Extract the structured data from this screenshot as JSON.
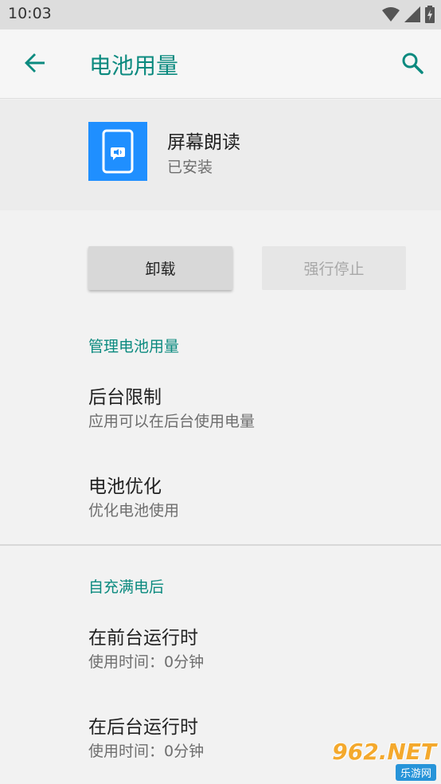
{
  "status_bar": {
    "time": "10:03",
    "icons": [
      "wifi-icon",
      "signal-icon",
      "battery-icon"
    ]
  },
  "app_bar": {
    "title": "电池用量",
    "back_icon": "arrow-back-icon",
    "search_icon": "search-icon",
    "accent_color": "#0b8a7f"
  },
  "app_info": {
    "name": "屏幕朗读",
    "status": "已安装",
    "icon_color": "#1f8fff"
  },
  "buttons": {
    "uninstall": "卸载",
    "force_stop": "强行停止"
  },
  "sections": {
    "manage": {
      "header": "管理电池用量",
      "items": [
        {
          "title": "后台限制",
          "summary": "应用可以在后台使用电量"
        },
        {
          "title": "电池优化",
          "summary": "优化电池使用"
        }
      ]
    },
    "since_full": {
      "header": "自充满电后",
      "items": [
        {
          "title": "在前台运行时",
          "summary": "使用时间：0分钟"
        },
        {
          "title": "在后台运行时",
          "summary": "使用时间：0分钟"
        }
      ]
    }
  },
  "watermark": {
    "main": "962.NET",
    "sub": "乐游网"
  }
}
